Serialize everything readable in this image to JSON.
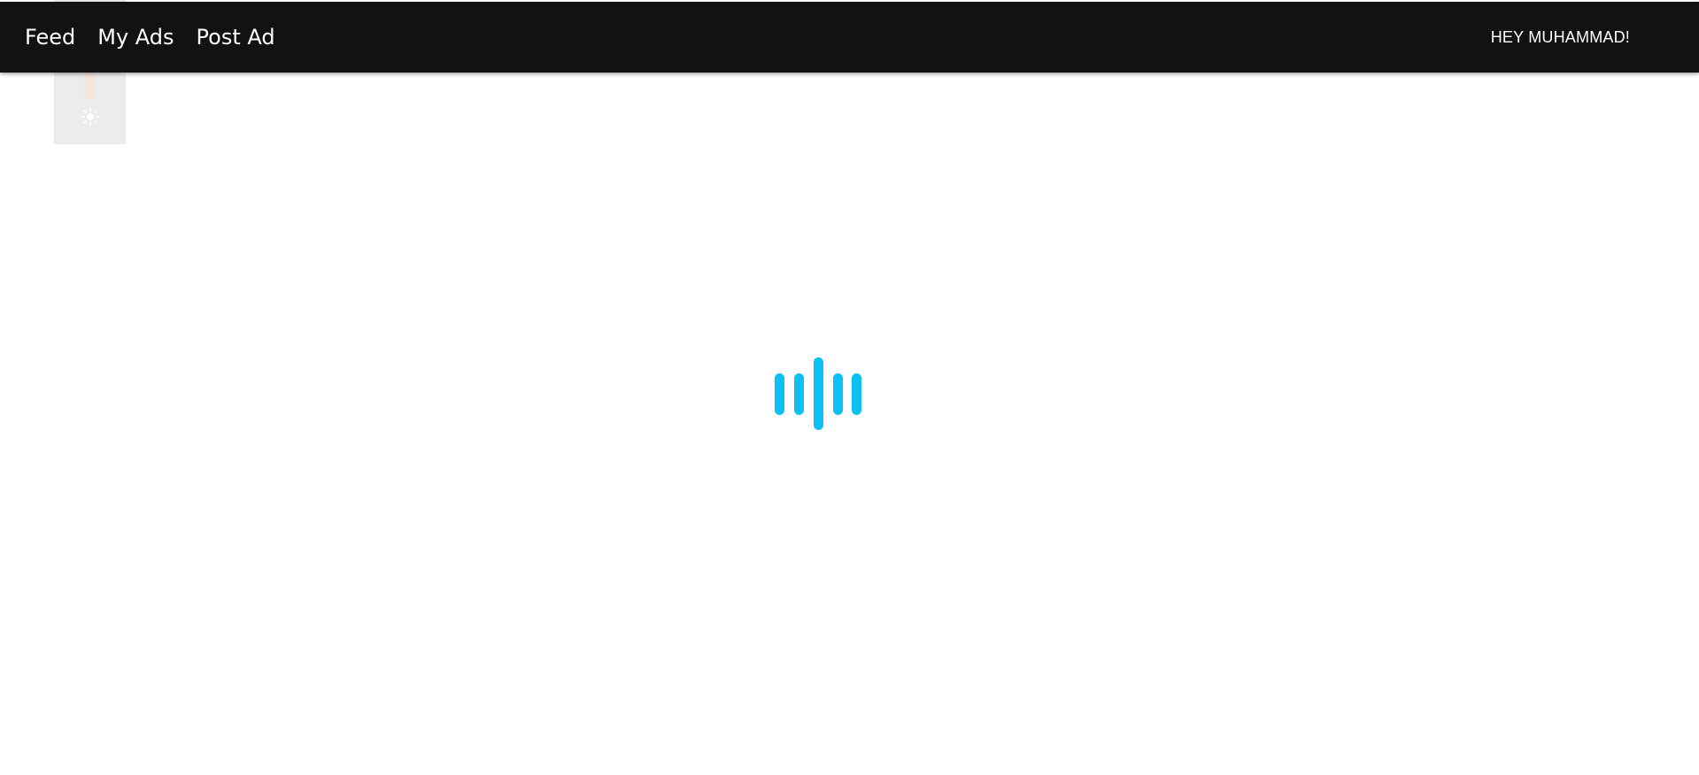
{
  "nav": {
    "links": [
      {
        "label": "Feed"
      },
      {
        "label": "My Ads"
      },
      {
        "label": "Post Ad"
      }
    ],
    "greeting": "HEY MUHAMMAD!"
  },
  "theme_widget": {
    "icon": "sun-icon",
    "level": 0.32
  },
  "loader": {
    "icon": "audio-bars-spinner",
    "color": "#0cc0f5"
  },
  "colors": {
    "navbar_bg": "#121212",
    "accent": "#0cc0f5"
  }
}
